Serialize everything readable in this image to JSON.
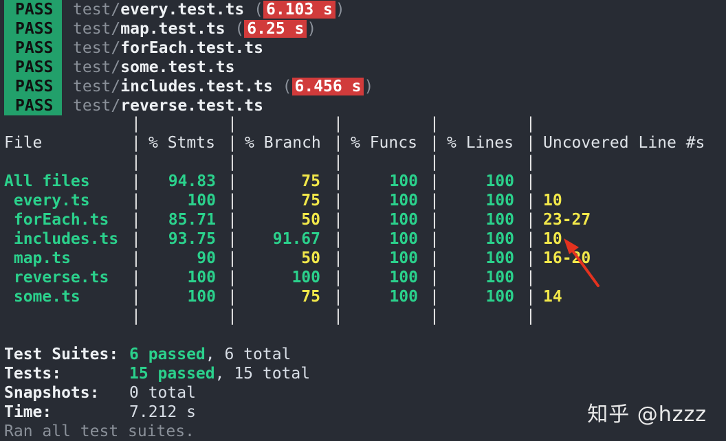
{
  "pass_rows": [
    {
      "badge": "PASS",
      "prefix": "test/",
      "file": "every.test.ts",
      "time": "6.103 s"
    },
    {
      "badge": "PASS",
      "prefix": "test/",
      "file": "map.test.ts",
      "time": "6.25 s"
    },
    {
      "badge": "PASS",
      "prefix": "test/",
      "file": "forEach.test.ts",
      "time": ""
    },
    {
      "badge": "PASS",
      "prefix": "test/",
      "file": "some.test.ts",
      "time": ""
    },
    {
      "badge": "PASS",
      "prefix": "test/",
      "file": "includes.test.ts",
      "time": "6.456 s"
    },
    {
      "badge": "PASS",
      "prefix": "test/",
      "file": "reverse.test.ts",
      "time": ""
    }
  ],
  "table": {
    "headers": [
      "File",
      "% Stmts",
      "% Branch",
      "% Funcs",
      "% Lines",
      "Uncovered Line #s"
    ],
    "rows": [
      {
        "file": "All files",
        "stmts": "94.83",
        "branch": "75",
        "funcs": "100",
        "lines": "100",
        "uncovered": ""
      },
      {
        "file": " every.ts",
        "stmts": "100",
        "branch": "75",
        "funcs": "100",
        "lines": "100",
        "uncovered": "10"
      },
      {
        "file": " forEach.ts",
        "stmts": "85.71",
        "branch": "50",
        "funcs": "100",
        "lines": "100",
        "uncovered": "23-27"
      },
      {
        "file": " includes.ts",
        "stmts": "93.75",
        "branch": "91.67",
        "funcs": "100",
        "lines": "100",
        "uncovered": "10"
      },
      {
        "file": " map.ts",
        "stmts": "90",
        "branch": "50",
        "funcs": "100",
        "lines": "100",
        "uncovered": "16-20"
      },
      {
        "file": " reverse.ts",
        "stmts": "100",
        "branch": "100",
        "funcs": "100",
        "lines": "100",
        "uncovered": ""
      },
      {
        "file": " some.ts",
        "stmts": "100",
        "branch": "75",
        "funcs": "100",
        "lines": "100",
        "uncovered": "14"
      }
    ],
    "branch_colors": [
      "yellow",
      "yellow",
      "yellow",
      "green",
      "yellow",
      "green",
      "yellow"
    ]
  },
  "summary": {
    "suites_label": "Test Suites:",
    "suites_passed": "6 passed",
    "suites_total": ", 6 total",
    "tests_label": "Tests:",
    "tests_passed": "15 passed",
    "tests_total": ", 15 total",
    "snap_label": "Snapshots:",
    "snap_val": "0 total",
    "time_label": "Time:",
    "time_val": "7.212 s",
    "ran_text": "Ran all test suites."
  },
  "watermark": "知乎 @hzzz",
  "colors": {
    "pass_bg": "#22a06b",
    "time_bg": "#d13b3b",
    "green": "#2bd18c",
    "yellow": "#f2e84a",
    "background": "#282c34"
  }
}
